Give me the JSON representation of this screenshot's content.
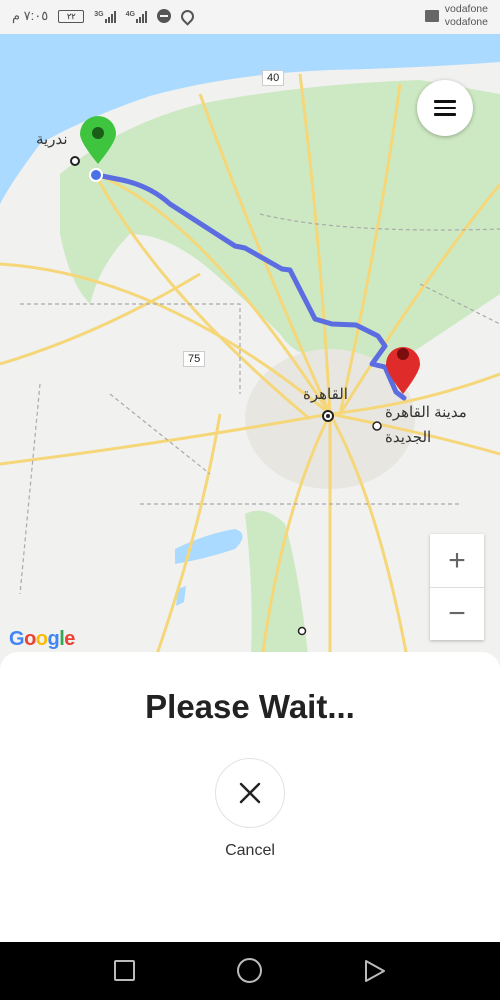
{
  "status_bar": {
    "time": "٧:٠٥ م",
    "battery": "٢٢",
    "network_1": "3G",
    "network_2": "4G",
    "carrier_1": "vodafone",
    "carrier_2": "vodafone"
  },
  "map": {
    "labels": {
      "origin_city": "ندرية",
      "cairo": "القاهرة",
      "new_cairo_line1": "مدينة القاهرة",
      "new_cairo_line2": "الجديدة"
    },
    "road_badges": [
      "40",
      "75"
    ],
    "menu_icon": "hamburger-icon",
    "zoom_in": "+",
    "zoom_out": "−",
    "attribution": "Google",
    "colors": {
      "route": "#5b6de0",
      "origin_marker": "#3ec43e",
      "destination_marker": "#e02b2b",
      "water": "#aadaff",
      "park": "#cde9c3",
      "roads": "#f5d77a"
    }
  },
  "sheet": {
    "title": "Please Wait...",
    "cancel_icon": "close-icon",
    "cancel_label": "Cancel"
  },
  "nav_bar": {
    "recents_icon": "square-icon",
    "home_icon": "circle-icon",
    "back_icon": "triangle-back-icon"
  }
}
